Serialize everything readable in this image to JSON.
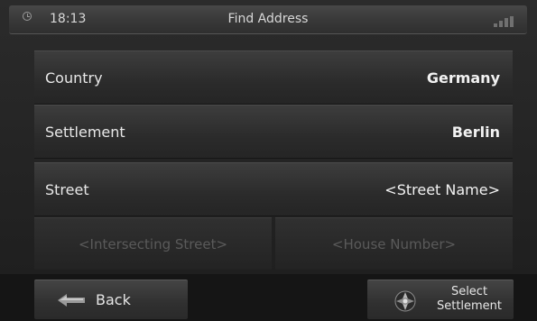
{
  "statusbar": {
    "time": "18:13",
    "title": "Find Address"
  },
  "rows": {
    "country": {
      "label": "Country",
      "value": "Germany"
    },
    "settlement": {
      "label": "Settlement",
      "value": "Berlin"
    },
    "street": {
      "label": "Street",
      "value": "<Street Name>"
    }
  },
  "optional": {
    "intersecting": "<Intersecting Street>",
    "house": "<House Number>"
  },
  "buttons": {
    "back": "Back",
    "select_line1": "Select",
    "select_line2": "Settlement"
  },
  "icons": [
    "clock-icon",
    "signal-icon",
    "back-arrow-icon",
    "compass-icon"
  ]
}
